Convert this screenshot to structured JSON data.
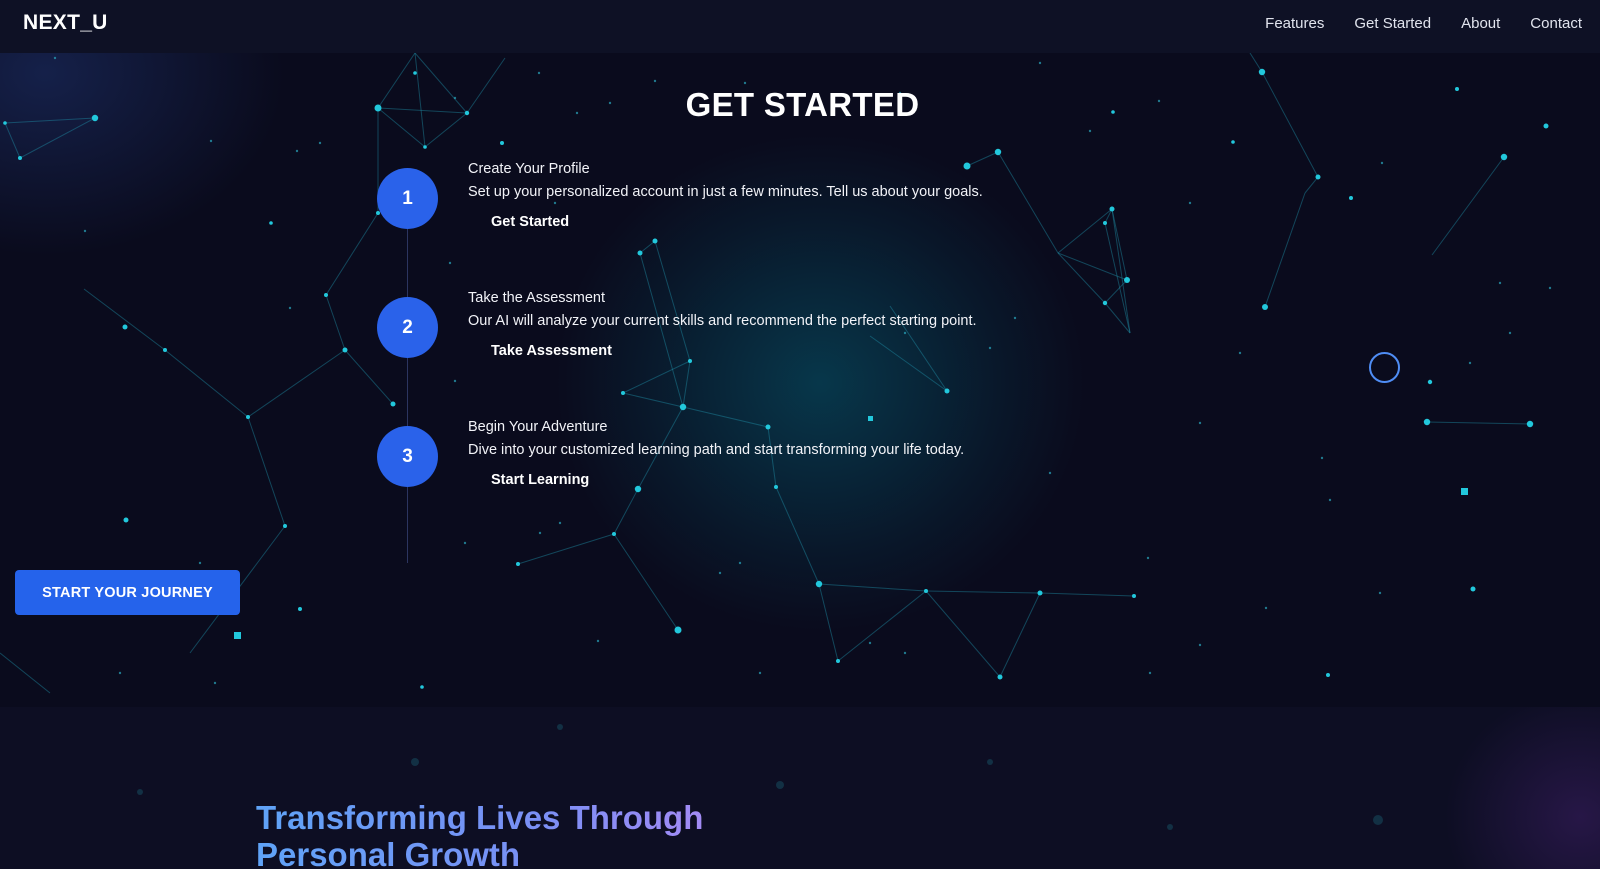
{
  "nav": {
    "logo": "NEXT_U",
    "links": [
      "Features",
      "Get Started",
      "About",
      "Contact"
    ]
  },
  "get_started": {
    "title": "GET STARTED",
    "steps": [
      {
        "number": "1",
        "title": "Create Your Profile",
        "description": "Set up your personalized account in just a few minutes. Tell us about your goals.",
        "action": "Get Started"
      },
      {
        "number": "2",
        "title": "Take the Assessment",
        "description": "Our AI will analyze your current skills and recommend the perfect starting point.",
        "action": "Take Assessment"
      },
      {
        "number": "3",
        "title": "Begin Your Adventure",
        "description": "Dive into your customized learning path and start transforming your life today.",
        "action": "Start Learning"
      }
    ],
    "cta": "START YOUR JOURNEY"
  },
  "mission": {
    "headline": "Transforming Lives Through Personal Growth"
  },
  "colors": {
    "background": "#0a0b1c",
    "navbar": "#0e1125",
    "accent": "#2563eb",
    "particle": "#22c8dc",
    "gradient_start": "#5fa3f7",
    "gradient_end": "#b489f5"
  },
  "icons": {
    "cursor": "cursor-ring-icon"
  }
}
